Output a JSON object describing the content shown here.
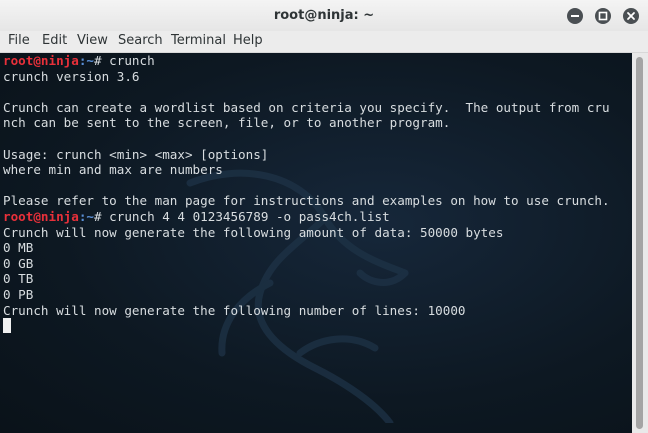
{
  "window": {
    "title": "root@ninja: ~"
  },
  "menu": {
    "file": "File",
    "edit": "Edit",
    "view": "View",
    "search": "Search",
    "terminal": "Terminal",
    "help": "Help"
  },
  "terminal": {
    "prompt_user": "root@ninja",
    "prompt_path": ":~",
    "prompt_symbol": "# ",
    "cmd1": "crunch",
    "out1": "crunch version 3.6",
    "out2": "Crunch can create a wordlist based on criteria you specify.  The output from cru",
    "out3": "nch can be sent to the screen, file, or to another program.",
    "out4": "Usage: crunch <min> <max> [options]",
    "out5": "where min and max are numbers",
    "out6": "Please refer to the man page for instructions and examples on how to use crunch.",
    "cmd2": "crunch 4 4 0123456789 -o pass4ch.list",
    "out7": "Crunch will now generate the following amount of data: 50000 bytes",
    "out8": "0 MB",
    "out9": "0 GB",
    "out10": "0 TB",
    "out11": "0 PB",
    "out12": "Crunch will now generate the following number of lines: 10000"
  },
  "colors": {
    "background": "#0e1a24",
    "prompt_user": "#e8303a",
    "prompt_path": "#5a8fd6",
    "text": "#d8dde0"
  },
  "icons": [
    "minimize-icon",
    "maximize-icon",
    "close-icon",
    "kali-dragon-icon"
  ]
}
